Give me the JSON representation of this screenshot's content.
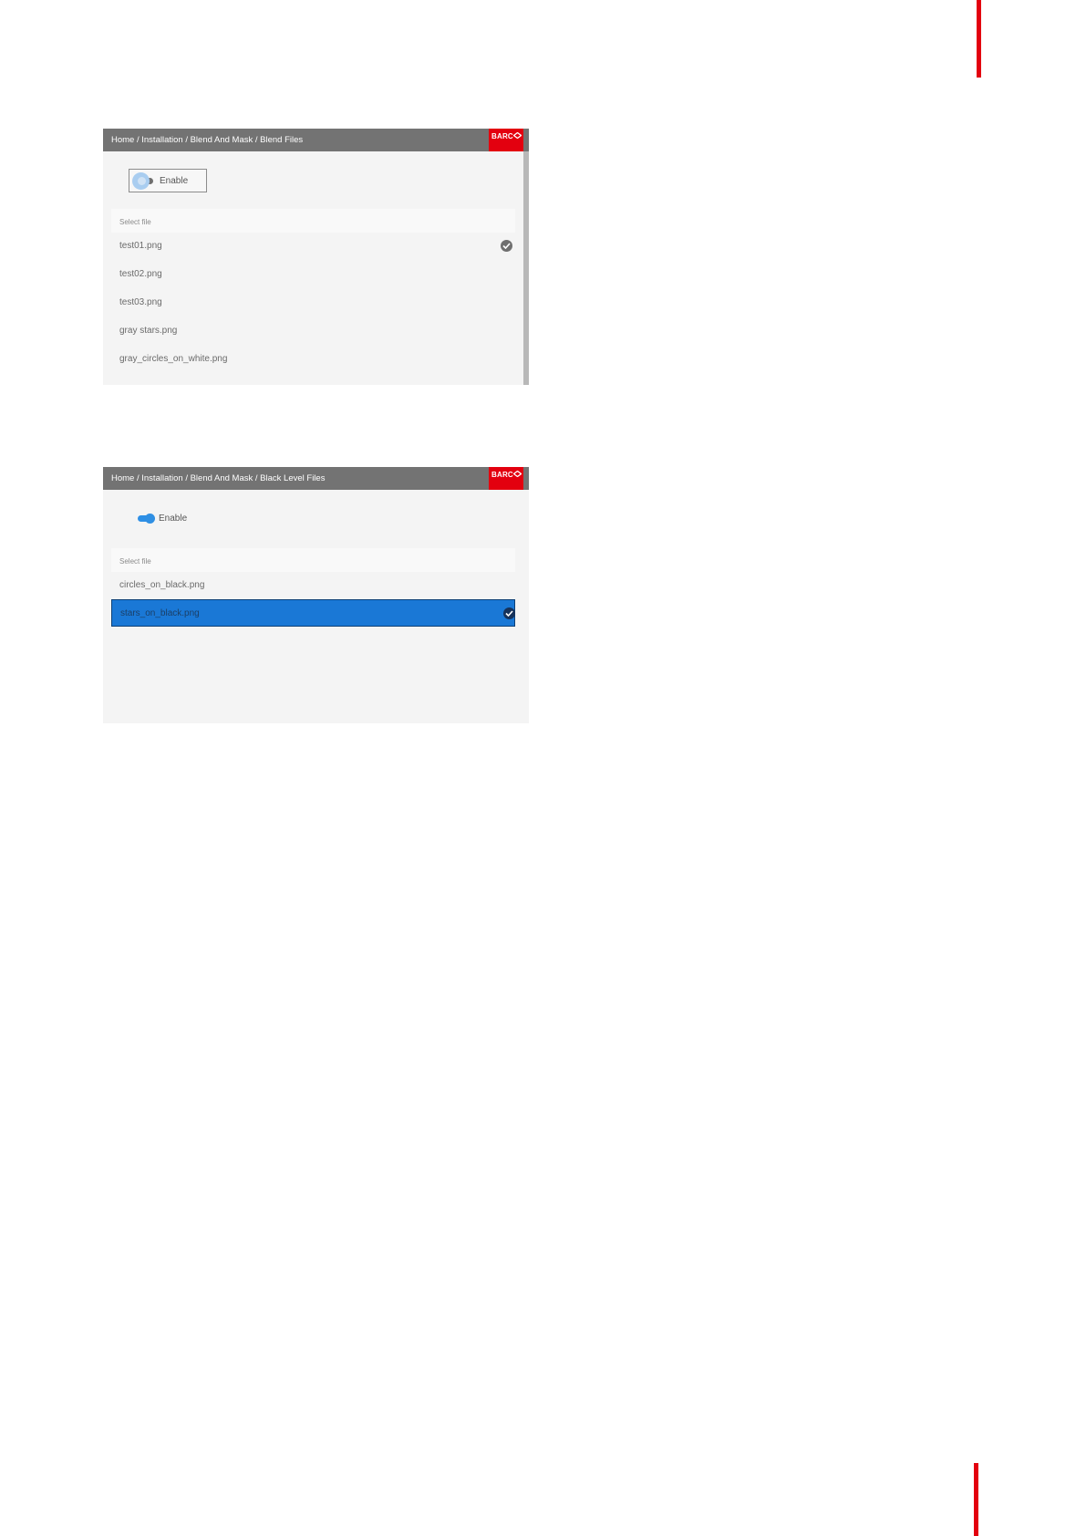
{
  "colors": {
    "brand_red": "#e3000f",
    "selected_blue": "#1a78d6",
    "header_gray": "#737373"
  },
  "logo": {
    "text": "BARC",
    "icon": "barco-logo-icon"
  },
  "panels": [
    {
      "breadcrumb": "Home / Installation / Blend And Mask / Blend Files",
      "toggle": {
        "label": "Enable",
        "state": "off"
      },
      "list_header": "Select file",
      "files": [
        {
          "name": "test01.png",
          "checked": true
        },
        {
          "name": "test02.png",
          "checked": false
        },
        {
          "name": "test03.png",
          "checked": false
        },
        {
          "name": "gray stars.png",
          "checked": false
        },
        {
          "name": "gray_circles_on_white.png",
          "checked": false
        }
      ]
    },
    {
      "breadcrumb": "Home / Installation / Blend And Mask / Black Level Files",
      "toggle": {
        "label": "Enable",
        "state": "on"
      },
      "list_header": "Select file",
      "files": [
        {
          "name": "circles_on_black.png",
          "checked": false
        },
        {
          "name": "stars_on_black.png",
          "checked": true,
          "selected": true
        }
      ]
    }
  ]
}
